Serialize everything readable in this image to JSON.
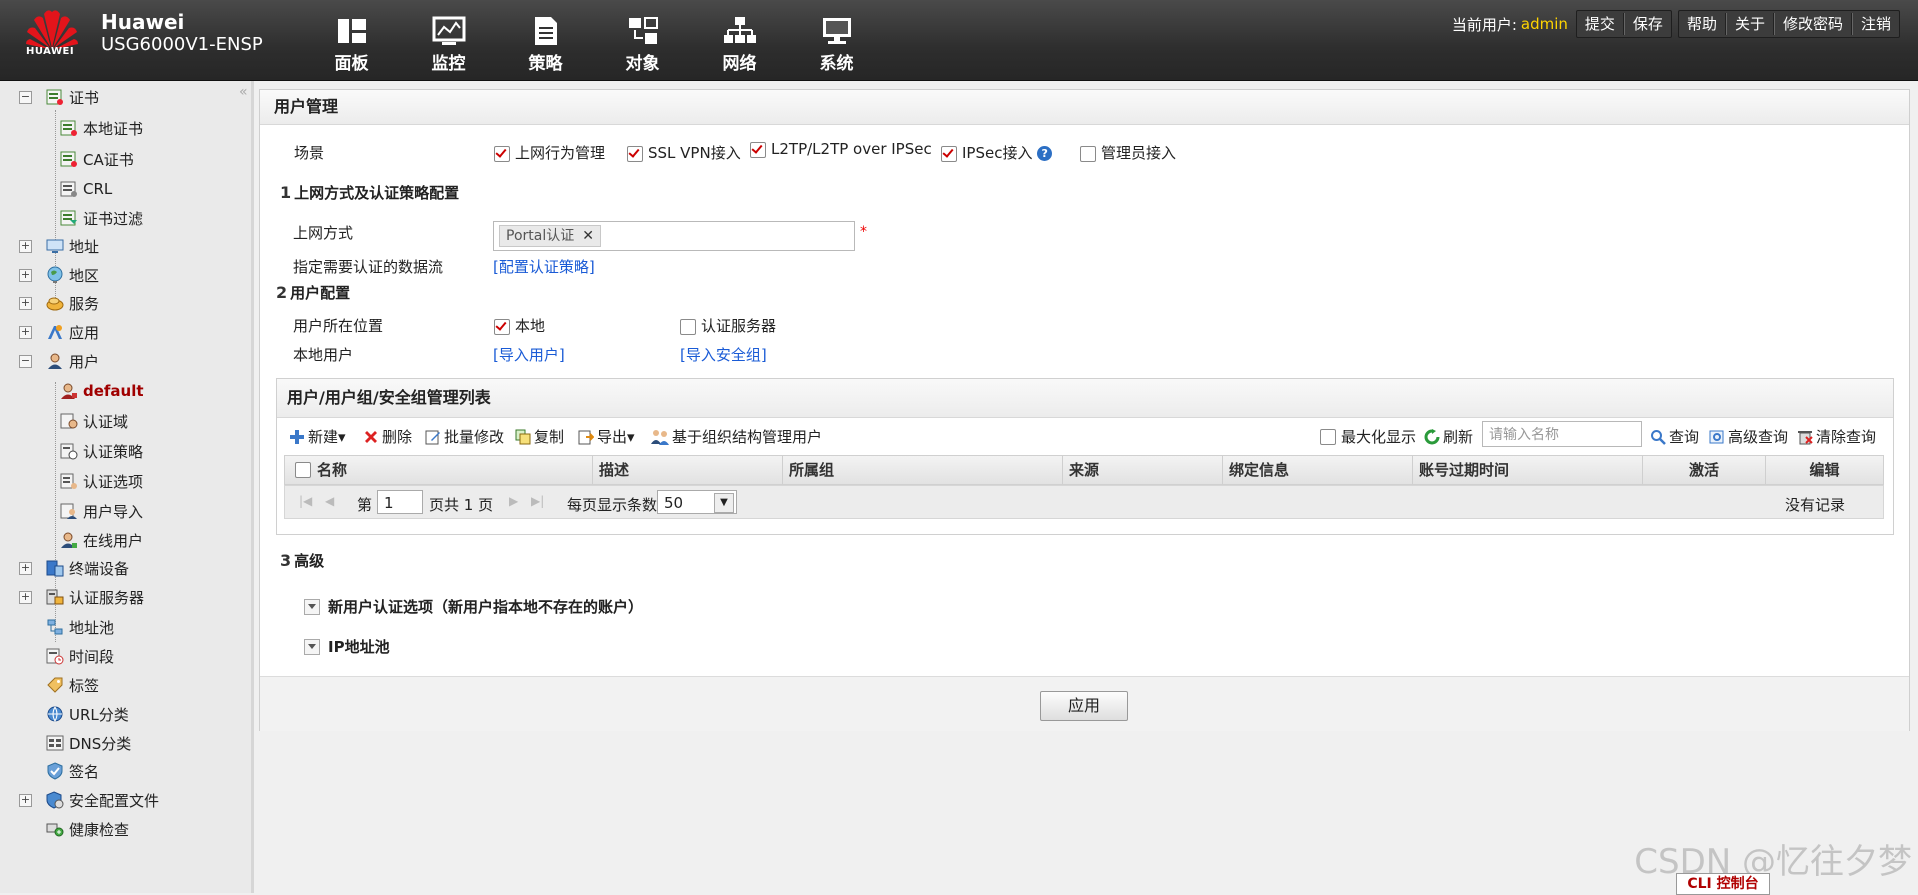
{
  "header": {
    "logo_text": "HUAWEI",
    "brand_line1": "Huawei",
    "brand_line2": "USG6000V1-ENSP",
    "nav": [
      {
        "label": "面板",
        "icon": "dashboard-icon"
      },
      {
        "label": "监控",
        "icon": "monitor-icon"
      },
      {
        "label": "策略",
        "icon": "policy-icon"
      },
      {
        "label": "对象",
        "icon": "object-icon"
      },
      {
        "label": "网络",
        "icon": "network-icon"
      },
      {
        "label": "系统",
        "icon": "system-icon"
      }
    ],
    "current_user_label": "当前用户:",
    "current_user": "admin",
    "links": {
      "submit": "提交",
      "save": "保存",
      "help": "帮助",
      "about": "关于",
      "change_password": "修改密码",
      "logout": "注销"
    }
  },
  "sidebar": {
    "items": [
      {
        "label": "证书",
        "icon": "certificate-icon",
        "expander": "minus"
      },
      {
        "label": "本地证书",
        "icon": "local-cert-icon"
      },
      {
        "label": "CA证书",
        "icon": "ca-cert-icon"
      },
      {
        "label": "CRL",
        "icon": "crl-icon"
      },
      {
        "label": "证书过滤",
        "icon": "cert-filter-icon"
      },
      {
        "label": "地址",
        "icon": "address-icon",
        "expander": "plus"
      },
      {
        "label": "地区",
        "icon": "region-globe-icon",
        "expander": "plus"
      },
      {
        "label": "服务",
        "icon": "service-icon",
        "expander": "plus"
      },
      {
        "label": "应用",
        "icon": "application-icon",
        "expander": "plus"
      },
      {
        "label": "用户",
        "icon": "user-icon",
        "expander": "minus"
      },
      {
        "label": "default",
        "icon": "user-default-icon",
        "selected": true
      },
      {
        "label": "认证域",
        "icon": "auth-domain-icon"
      },
      {
        "label": "认证策略",
        "icon": "auth-policy-icon"
      },
      {
        "label": "认证选项",
        "icon": "auth-option-icon"
      },
      {
        "label": "用户导入",
        "icon": "user-import-icon"
      },
      {
        "label": "在线用户",
        "icon": "online-user-icon"
      },
      {
        "label": "终端设备",
        "icon": "terminal-device-icon",
        "expander": "plus"
      },
      {
        "label": "认证服务器",
        "icon": "auth-server-icon",
        "expander": "plus"
      },
      {
        "label": "地址池",
        "icon": "address-pool-icon"
      },
      {
        "label": "时间段",
        "icon": "time-range-icon"
      },
      {
        "label": "标签",
        "icon": "tag-icon"
      },
      {
        "label": "URL分类",
        "icon": "url-category-icon"
      },
      {
        "label": "DNS分类",
        "icon": "dns-category-icon"
      },
      {
        "label": "签名",
        "icon": "signature-icon"
      },
      {
        "label": "安全配置文件",
        "icon": "security-profile-icon",
        "expander": "plus"
      },
      {
        "label": "健康检查",
        "icon": "health-check-icon"
      }
    ]
  },
  "main": {
    "title": "用户管理",
    "scene": {
      "label": "场景",
      "options": [
        {
          "label": "上网行为管理",
          "checked": true
        },
        {
          "label": "SSL VPN接入",
          "checked": true
        },
        {
          "label": "L2TP/L2TP over IPSec",
          "checked": true
        },
        {
          "label": "IPSec接入",
          "checked": true
        },
        {
          "label": "管理员接入",
          "checked": false
        }
      ]
    },
    "section1": {
      "num": "1",
      "title": "上网方式及认证策略配置",
      "access_label": "上网方式",
      "access_tag": "Portal认证",
      "required_mark": "*",
      "dataflow_label": "指定需要认证的数据流",
      "dataflow_link": "[配置认证策略]"
    },
    "section2": {
      "num": "2",
      "title": "用户配置",
      "location_label": "用户所在位置",
      "loc_local": "本地",
      "loc_local_checked": true,
      "loc_server": "认证服务器",
      "loc_server_checked": false,
      "local_user_label": "本地用户",
      "import_users": "[导入用户]",
      "import_groups": "[导入安全组]"
    },
    "list": {
      "title": "用户/用户组/安全组管理列表",
      "toolbar": {
        "new": "新建",
        "delete": "删除",
        "batch_edit": "批量修改",
        "copy": "复制",
        "export": "导出",
        "org_manage": "基于组织结构管理用户",
        "maximize": "最大化显示",
        "refresh": "刷新",
        "search_placeholder": "请输入名称",
        "query": "查询",
        "advanced_query": "高级查询",
        "clear_query": "清除查询"
      },
      "columns": [
        "名称",
        "描述",
        "所属组",
        "来源",
        "绑定信息",
        "账号过期时间",
        "激活",
        "编辑"
      ],
      "pager": {
        "page_prefix": "第",
        "page_value": "1",
        "page_suffix": "页共 1 页",
        "per_page_label": "每页显示条数",
        "per_page_value": "50",
        "no_records": "没有记录"
      }
    },
    "section3": {
      "num": "3",
      "title": "高级",
      "adv1": "新用户认证选项（新用户指本地不存在的账户）",
      "adv2": "IP地址池"
    },
    "apply": "应用"
  },
  "footer": {
    "watermark": "CSDN @忆往夕梦",
    "cli": "CLI 控制台"
  },
  "colors": {
    "header_bg": "#2e2e2e",
    "username": "#ffd400",
    "link": "#1a5bd6",
    "selected": "#a00000",
    "check": "#cc0000"
  }
}
